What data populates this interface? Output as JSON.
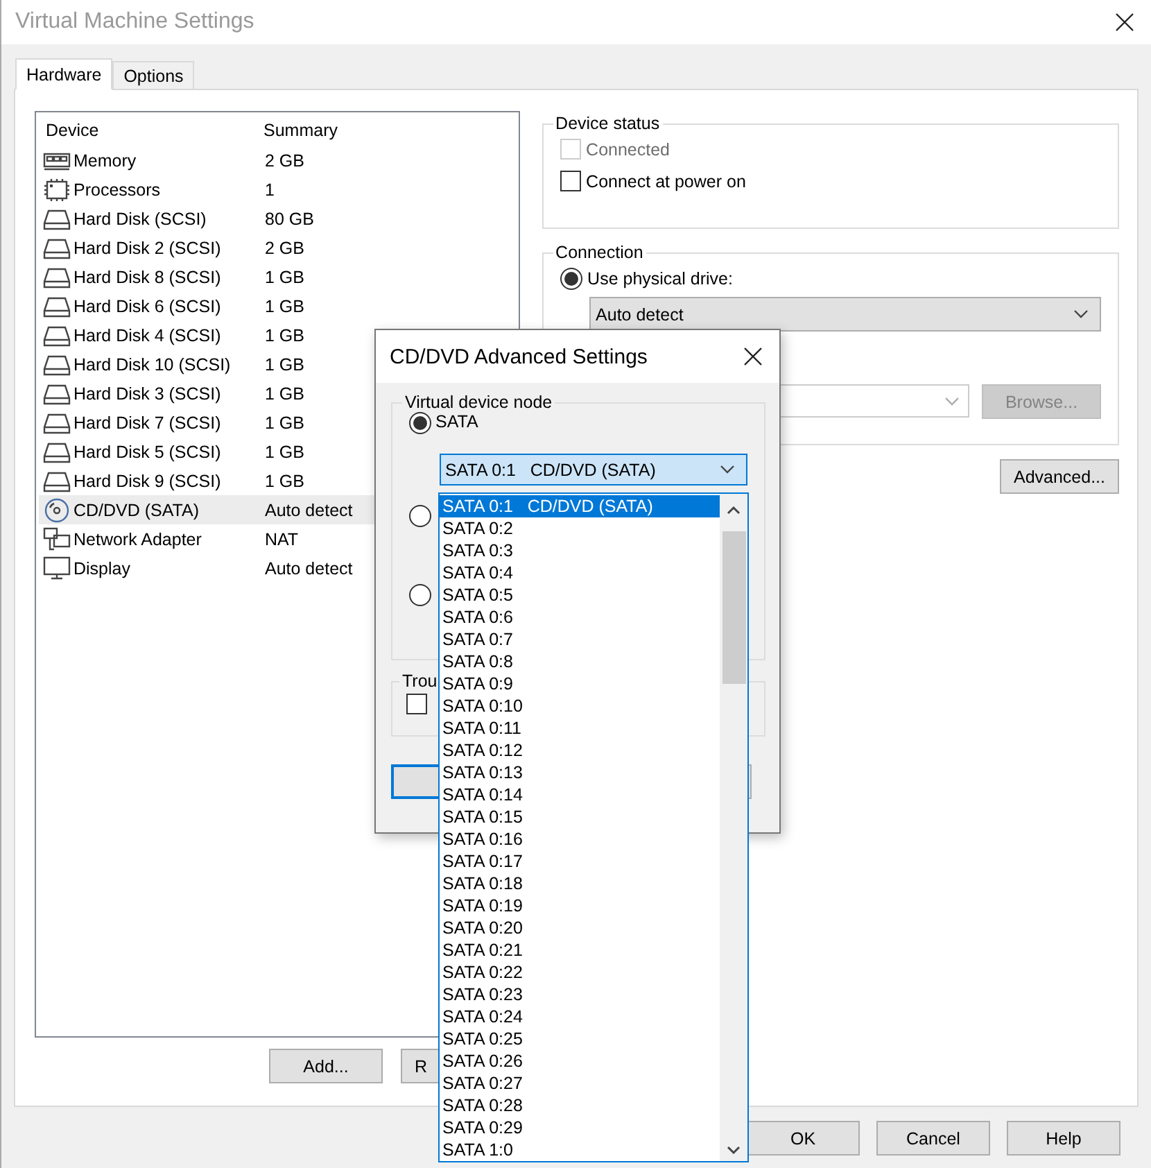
{
  "window": {
    "title": "Virtual Machine Settings"
  },
  "tabs": [
    {
      "label": "Hardware",
      "selected": true
    },
    {
      "label": "Options",
      "selected": false
    }
  ],
  "device_table": {
    "columns": [
      "Device",
      "Summary"
    ],
    "rows": [
      {
        "kind": "memory",
        "device": "Memory",
        "summary": "2 GB",
        "selected": false
      },
      {
        "kind": "cpu",
        "device": "Processors",
        "summary": "1",
        "selected": false
      },
      {
        "kind": "disk",
        "device": "Hard Disk (SCSI)",
        "summary": "80 GB",
        "selected": false
      },
      {
        "kind": "disk",
        "device": "Hard Disk 2 (SCSI)",
        "summary": "2 GB",
        "selected": false
      },
      {
        "kind": "disk",
        "device": "Hard Disk 8 (SCSI)",
        "summary": "1 GB",
        "selected": false
      },
      {
        "kind": "disk",
        "device": "Hard Disk 6 (SCSI)",
        "summary": "1 GB",
        "selected": false
      },
      {
        "kind": "disk",
        "device": "Hard Disk 4 (SCSI)",
        "summary": "1 GB",
        "selected": false
      },
      {
        "kind": "disk",
        "device": "Hard Disk 10 (SCSI)",
        "summary": "1 GB",
        "selected": false
      },
      {
        "kind": "disk",
        "device": "Hard Disk 3 (SCSI)",
        "summary": "1 GB",
        "selected": false
      },
      {
        "kind": "disk",
        "device": "Hard Disk 7 (SCSI)",
        "summary": "1 GB",
        "selected": false
      },
      {
        "kind": "disk",
        "device": "Hard Disk 5 (SCSI)",
        "summary": "1 GB",
        "selected": false
      },
      {
        "kind": "disk",
        "device": "Hard Disk 9 (SCSI)",
        "summary": "1 GB",
        "selected": false
      },
      {
        "kind": "cd",
        "device": "CD/DVD (SATA)",
        "summary": "Auto detect",
        "selected": true
      },
      {
        "kind": "network",
        "device": "Network Adapter",
        "summary": "NAT",
        "selected": false
      },
      {
        "kind": "display",
        "device": "Display",
        "summary": "Auto detect",
        "selected": false
      }
    ]
  },
  "device_buttons": [
    "Add...",
    "R"
  ],
  "device_status": {
    "title": "Device status",
    "options": [
      {
        "label": "Connected",
        "checked": false,
        "disabled": true
      },
      {
        "label": "Connect at power on",
        "checked": false,
        "disabled": false
      }
    ]
  },
  "connection": {
    "title": "Connection",
    "physical_radio": {
      "label": "Use physical drive:",
      "selected": true
    },
    "drive_select": {
      "value": "Auto detect"
    },
    "browse_button": {
      "label": "Browse...",
      "disabled": true
    }
  },
  "advanced_button": "Advanced...",
  "buttons": [
    "OK",
    "Cancel",
    "Help"
  ],
  "dialog": {
    "title": "CD/DVD Advanced Settings",
    "node_group": {
      "title": "Virtual device node",
      "radios": [
        {
          "label": "SATA",
          "selected": true
        },
        {
          "selected": false
        },
        {
          "selected": false
        }
      ],
      "select_value": "SATA 0:1   CD/DVD (SATA)"
    },
    "trouble_group": {
      "title": "Trou",
      "checked": false
    },
    "dropdown": [
      {
        "label": "SATA 0:1   CD/DVD (SATA)",
        "selected": true
      },
      {
        "label": "SATA 0:2",
        "selected": false
      },
      {
        "label": "SATA 0:3",
        "selected": false
      },
      {
        "label": "SATA 0:4",
        "selected": false
      },
      {
        "label": "SATA 0:5",
        "selected": false
      },
      {
        "label": "SATA 0:6",
        "selected": false
      },
      {
        "label": "SATA 0:7",
        "selected": false
      },
      {
        "label": "SATA 0:8",
        "selected": false
      },
      {
        "label": "SATA 0:9",
        "selected": false
      },
      {
        "label": "SATA 0:10",
        "selected": false
      },
      {
        "label": "SATA 0:11",
        "selected": false
      },
      {
        "label": "SATA 0:12",
        "selected": false
      },
      {
        "label": "SATA 0:13",
        "selected": false
      },
      {
        "label": "SATA 0:14",
        "selected": false
      },
      {
        "label": "SATA 0:15",
        "selected": false
      },
      {
        "label": "SATA 0:16",
        "selected": false
      },
      {
        "label": "SATA 0:17",
        "selected": false
      },
      {
        "label": "SATA 0:18",
        "selected": false
      },
      {
        "label": "SATA 0:19",
        "selected": false
      },
      {
        "label": "SATA 0:20",
        "selected": false
      },
      {
        "label": "SATA 0:21",
        "selected": false
      },
      {
        "label": "SATA 0:22",
        "selected": false
      },
      {
        "label": "SATA 0:23",
        "selected": false
      },
      {
        "label": "SATA 0:24",
        "selected": false
      },
      {
        "label": "SATA 0:25",
        "selected": false
      },
      {
        "label": "SATA 0:26",
        "selected": false
      },
      {
        "label": "SATA 0:27",
        "selected": false
      },
      {
        "label": "SATA 0:28",
        "selected": false
      },
      {
        "label": "SATA 0:29",
        "selected": false
      },
      {
        "label": "SATA 1:0",
        "selected": false
      }
    ]
  }
}
